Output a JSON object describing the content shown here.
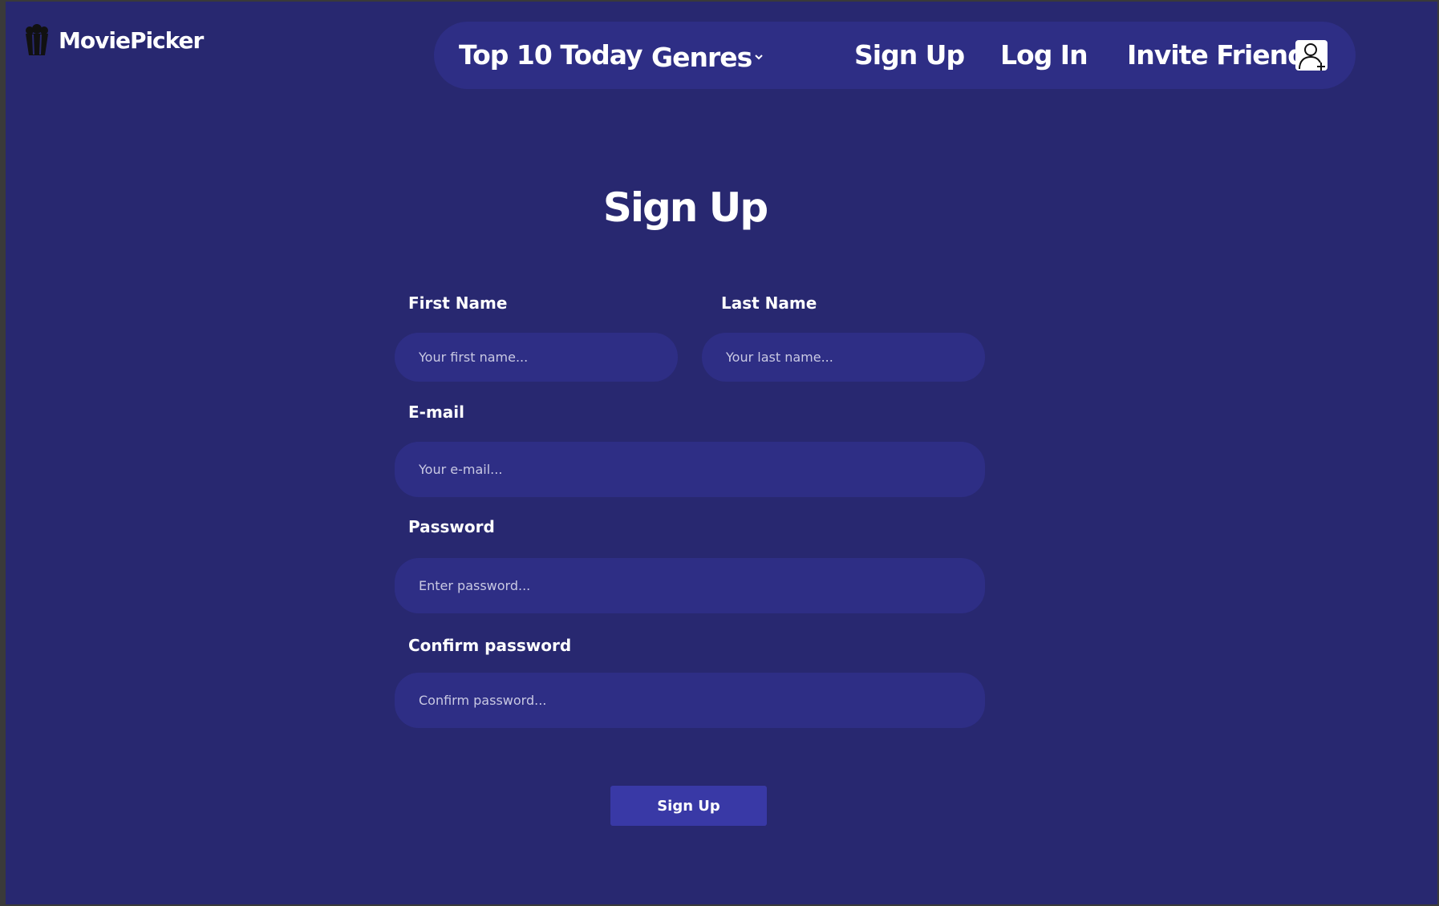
{
  "app": {
    "name": "MoviePicker",
    "logo_icon": "popcorn-icon"
  },
  "nav": {
    "items": [
      {
        "label": "Top 10 Today"
      },
      {
        "label": "Genres",
        "icon": "chevron-down-icon"
      },
      {
        "label": "Sign Up"
      },
      {
        "label": "Log In"
      },
      {
        "label": "Invite Friends",
        "icon": "add-user-icon"
      }
    ]
  },
  "form": {
    "title": "Sign Up",
    "first_name": {
      "label": "First Name",
      "placeholder": "Your first name...",
      "value": ""
    },
    "last_name": {
      "label": "Last Name",
      "placeholder": "Your last name...",
      "value": ""
    },
    "email": {
      "label": "E-mail",
      "placeholder": "Your e-mail...",
      "value": ""
    },
    "password": {
      "label": "Password",
      "placeholder": "Enter password...",
      "value": ""
    },
    "confirm_password": {
      "label": "Confirm password",
      "placeholder": "Confirm password...",
      "value": ""
    },
    "submit_label": "Sign Up"
  },
  "colors": {
    "page_background": "#282870",
    "nav_background": "#2e2e85",
    "input_background": "#2e2e85",
    "button_background": "#3939a6",
    "text": "#ffffff"
  }
}
